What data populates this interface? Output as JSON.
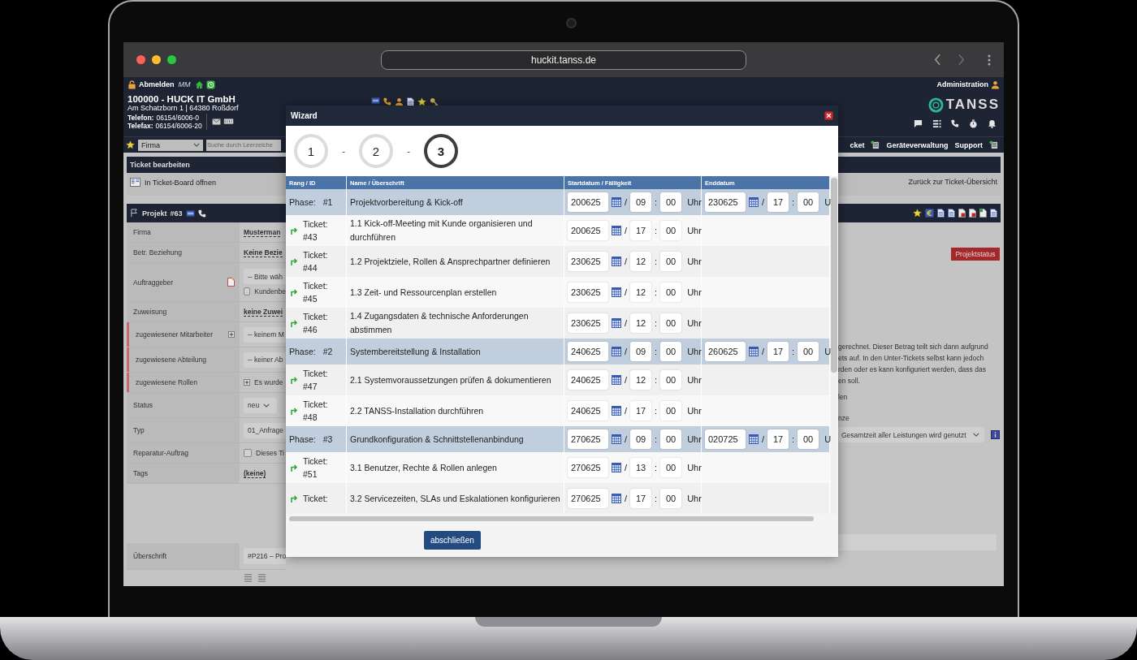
{
  "browser": {
    "url": "huckit.tanss.de"
  },
  "topbar": {
    "logout": "Abmelden",
    "user": "MM",
    "admin": "Administration"
  },
  "company": {
    "name": "100000 - HUCK IT GmbH",
    "address": "Am Schatzborn 1 | 64380 Roßdorf",
    "phone_label": "Telefon:",
    "phone": "06154/6006-0",
    "fax_label": "Telefax:",
    "fax": "06154/6006-20"
  },
  "logo": "TANSS",
  "nav": {
    "scope": "Firma",
    "search_placeholder": "Suche durch Leerzeiche",
    "items": [
      "cket",
      "Geräteverwaltung",
      "Support"
    ]
  },
  "section": {
    "title": "Ticket bearbeiten",
    "board_link": "In Ticket-Board öffnen",
    "back_link": "Zurück zur Ticket-Übersicht"
  },
  "project": {
    "label": "Projekt",
    "number": "#63"
  },
  "form": {
    "fields": [
      {
        "label": "Firma",
        "kind": "link",
        "value": "Musterman",
        "assigned": false
      },
      {
        "label": "Betr. Beziehung",
        "kind": "link",
        "value": "Keine Bezie",
        "assigned": false
      },
      {
        "label": "Auftraggeber",
        "kind": "select_check",
        "value": "-- Bitte wäh",
        "check_label": "Kundenbe",
        "checked": false,
        "assigned": false
      },
      {
        "label": "Zuweisung",
        "kind": "link",
        "value": "keine Zuwei",
        "assigned": false
      },
      {
        "label": "zugewiesener Mitarbeiter",
        "kind": "select_add",
        "value": "-- keinem M",
        "assigned": true
      },
      {
        "label": "zugewiesene Abteilung",
        "kind": "select",
        "value": "-- keiner Ab",
        "assigned": true
      },
      {
        "label": "zugewiesene Rollen",
        "kind": "plus",
        "value": "Es wurde",
        "assigned": true
      },
      {
        "label": "Status",
        "kind": "select",
        "value": "neu",
        "caret": true,
        "assigned": false
      },
      {
        "label": "Typ",
        "kind": "select",
        "value": "01_Anfrage",
        "assigned": false
      },
      {
        "label": "Reparatur-Auftrag",
        "kind": "checkbox",
        "value": "Dieses Ti",
        "checked": false,
        "assigned": false
      },
      {
        "label": "Tags",
        "kind": "link",
        "value": "(keine)",
        "assigned": false
      },
      {
        "label": "Überschrift",
        "kind": "text_field",
        "value": "#P216 – Pro",
        "assigned": false
      }
    ]
  },
  "right": {
    "status_button": "Projektstatus",
    "note_lines": [
      "gerechnet. Dieser Betrag teilt sich dann aufgrund",
      "ets auf. In den Unter-Tickets selbst kann jedoch",
      "rden oder es kann konfiguriert werden, dass das",
      "en soll."
    ],
    "options": [
      "len",
      "nze"
    ],
    "billing_select": "Gesamtzeit aller Leistungen wird genutzt"
  },
  "wizard": {
    "title": "Wizard",
    "steps": [
      {
        "label": "1",
        "selected": false
      },
      {
        "label": "2",
        "selected": false
      },
      {
        "label": "3",
        "selected": true
      }
    ],
    "step_separators": [
      "-",
      "-"
    ],
    "columns": [
      "Rang / ID",
      "Name / Überschrift",
      "Startdatum / Fälligkeit",
      "Enddatum"
    ],
    "rows": [
      {
        "kind": "phase",
        "rank": "Phase:",
        "id": "#1",
        "name": "Projektvorbereitung & Kick-off",
        "start": {
          "date": "200625",
          "sep": "/",
          "hour": "09",
          "colon": ":",
          "minute": "00",
          "unit": "Uhr"
        },
        "end": {
          "date": "230625",
          "sep": "/",
          "hour": "17",
          "colon": ":",
          "minute": "00",
          "unit": "U"
        }
      },
      {
        "kind": "ticket",
        "rank": "Ticket:",
        "id": "#43",
        "name": "1.1 Kick-off-Meeting mit Kunde organisieren und durchführen",
        "start": {
          "date": "200625",
          "sep": "/",
          "hour": "17",
          "colon": ":",
          "minute": "00",
          "unit": "Uhr"
        }
      },
      {
        "kind": "ticket",
        "rank": "Ticket:",
        "id": "#44",
        "name": "1.2 Projektziele, Rollen & Ansprechpartner definieren",
        "start": {
          "date": "230625",
          "sep": "/",
          "hour": "12",
          "colon": ":",
          "minute": "00",
          "unit": "Uhr"
        }
      },
      {
        "kind": "ticket",
        "rank": "Ticket:",
        "id": "#45",
        "name": "1.3 Zeit- und Ressourcenplan erstellen",
        "start": {
          "date": "230625",
          "sep": "/",
          "hour": "12",
          "colon": ":",
          "minute": "00",
          "unit": "Uhr"
        }
      },
      {
        "kind": "ticket",
        "rank": "Ticket:",
        "id": "#46",
        "name": "1.4 Zugangsdaten & technische Anforderungen abstimmen",
        "start": {
          "date": "230625",
          "sep": "/",
          "hour": "12",
          "colon": ":",
          "minute": "00",
          "unit": "Uhr"
        }
      },
      {
        "kind": "phase",
        "rank": "Phase:",
        "id": "#2",
        "name": "Systembereitstellung & Installation",
        "start": {
          "date": "240625",
          "sep": "/",
          "hour": "09",
          "colon": ":",
          "minute": "00",
          "unit": "Uhr"
        },
        "end": {
          "date": "260625",
          "sep": "/",
          "hour": "17",
          "colon": ":",
          "minute": "00",
          "unit": "U"
        }
      },
      {
        "kind": "ticket",
        "rank": "Ticket:",
        "id": "#47",
        "name": "2.1 Systemvoraussetzungen prüfen & dokumentieren",
        "start": {
          "date": "240625",
          "sep": "/",
          "hour": "12",
          "colon": ":",
          "minute": "00",
          "unit": "Uhr"
        }
      },
      {
        "kind": "ticket",
        "rank": "Ticket:",
        "id": "#48",
        "name": "2.2 TANSS-Installation durchführen",
        "start": {
          "date": "240625",
          "sep": "/",
          "hour": "17",
          "colon": ":",
          "minute": "00",
          "unit": "Uhr"
        }
      },
      {
        "kind": "phase",
        "rank": "Phase:",
        "id": "#3",
        "name": "Grundkonfiguration & Schnittstellenanbindung",
        "start": {
          "date": "270625",
          "sep": "/",
          "hour": "09",
          "colon": ":",
          "minute": "00",
          "unit": "Uhr"
        },
        "end": {
          "date": "020725",
          "sep": "/",
          "hour": "17",
          "colon": ":",
          "minute": "00",
          "unit": "U"
        }
      },
      {
        "kind": "ticket",
        "rank": "Ticket:",
        "id": "#51",
        "name": "3.1 Benutzer, Rechte & Rollen anlegen",
        "start": {
          "date": "270625",
          "sep": "/",
          "hour": "13",
          "colon": ":",
          "minute": "00",
          "unit": "Uhr"
        }
      },
      {
        "kind": "ticket",
        "rank": "Ticket:",
        "name": "3.2 Servicezeiten, SLAs und Eskalationen konfigurieren",
        "start": {
          "date": "270625",
          "sep": "/",
          "hour": "17",
          "colon": ":",
          "minute": "00",
          "unit": "Uhr"
        }
      }
    ],
    "finish_button": "abschließen"
  }
}
